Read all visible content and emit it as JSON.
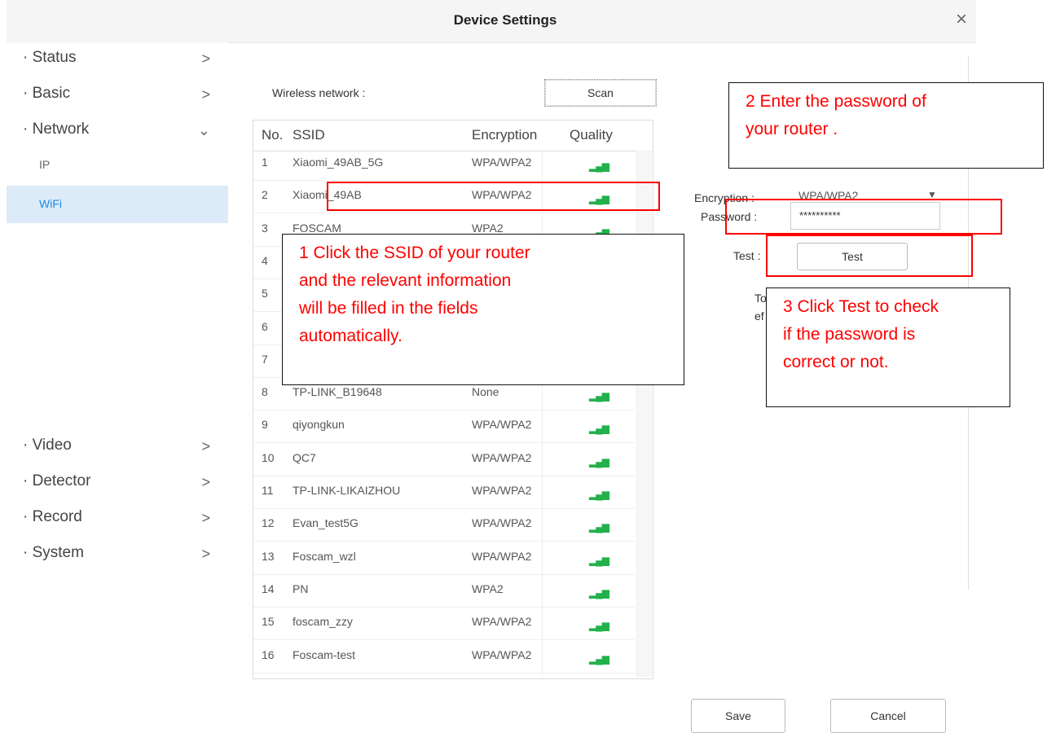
{
  "header": {
    "title": "Device Settings"
  },
  "sidebar": {
    "items": [
      {
        "label": "· Status",
        "chevron": ">"
      },
      {
        "label": "· Basic",
        "chevron": ">"
      },
      {
        "label": "· Network",
        "chevron": "⌄"
      },
      {
        "label": "· Video",
        "chevron": ">"
      },
      {
        "label": "· Detector",
        "chevron": ">"
      },
      {
        "label": "· Record",
        "chevron": ">"
      },
      {
        "label": "· System",
        "chevron": ">"
      }
    ],
    "sub": [
      {
        "label": "IP"
      },
      {
        "label": "WiFi"
      }
    ]
  },
  "wifi": {
    "label": "Wireless network :",
    "scan_label": "Scan",
    "columns": {
      "no": "No.",
      "ssid": "SSID",
      "enc": "Encryption",
      "quality": "Quality"
    },
    "rows": [
      {
        "no": "1",
        "ssid": "Xiaomi_49AB_5G",
        "enc": "WPA/WPA2",
        "q": "▂▄▆"
      },
      {
        "no": "2",
        "ssid": "Xiaomi_49AB",
        "enc": "WPA/WPA2",
        "q": "▂▄▆"
      },
      {
        "no": "3",
        "ssid": "FOSCAM",
        "enc": "WPA2",
        "q": "▂▄▆"
      },
      {
        "no": "4",
        "ssid": "",
        "enc": "",
        "q": ""
      },
      {
        "no": "5",
        "ssid": "",
        "enc": "",
        "q": ""
      },
      {
        "no": "6",
        "ssid": "",
        "enc": "",
        "q": ""
      },
      {
        "no": "7",
        "ssid": "",
        "enc": "",
        "q": ""
      },
      {
        "no": "8",
        "ssid": "TP-LINK_B19648",
        "enc": "None",
        "q": "▂▄▆"
      },
      {
        "no": "9",
        "ssid": "qiyongkun",
        "enc": "WPA/WPA2",
        "q": "▂▄▆"
      },
      {
        "no": "10",
        "ssid": "QC7",
        "enc": "WPA/WPA2",
        "q": "▂▄▆"
      },
      {
        "no": "11",
        "ssid": "TP-LINK-LIKAIZHOU",
        "enc": "WPA/WPA2",
        "q": "▂▄▆"
      },
      {
        "no": "12",
        "ssid": "Evan_test5G",
        "enc": "WPA/WPA2",
        "q": "▂▄▆"
      },
      {
        "no": "13",
        "ssid": "Foscam_wzl",
        "enc": "WPA/WPA2",
        "q": "▂▄▆"
      },
      {
        "no": "14",
        "ssid": "PN",
        "enc": "WPA2",
        "q": "▂▄▆"
      },
      {
        "no": "15",
        "ssid": "foscam_zzy",
        "enc": "WPA/WPA2",
        "q": "▂▄▆"
      },
      {
        "no": "16",
        "ssid": "Foscam-test",
        "enc": "WPA/WPA2",
        "q": "▂▄▆"
      }
    ]
  },
  "form": {
    "encryption_label": "Encryption :",
    "encryption_value": "WPA/WPA2",
    "password_label": "Password :",
    "password_value": "**********",
    "test_label": "Test :",
    "test_button": "Test",
    "note_partial_1": "To",
    "note_partial_2": "ef"
  },
  "footer": {
    "save": "Save",
    "cancel": "Cancel"
  },
  "callouts": {
    "c1": [
      "1 Click the SSID of your router",
      "and the relevant information",
      "will be filled in the fields",
      "automatically."
    ],
    "c2": [
      "2 Enter the password of",
      "your router ."
    ],
    "c3": [
      "3 Click Test to check",
      "if the password is",
      "correct or not."
    ]
  },
  "colors": {
    "accent": "#1e88e5",
    "active_bg": "#ddebf8",
    "annotation": "#ff0000",
    "signal": "#22b14c"
  }
}
